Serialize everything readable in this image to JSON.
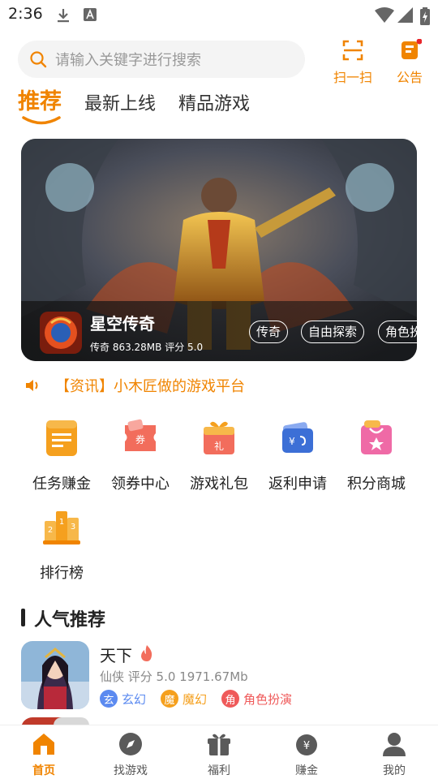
{
  "status_bar": {
    "time": "2:36",
    "icons": [
      "download-icon",
      "a-icon",
      "wifi-icon",
      "signal-icon",
      "battery-icon"
    ]
  },
  "search": {
    "placeholder": "请输入关键字进行搜索"
  },
  "top_actions": [
    {
      "label": "扫一扫",
      "icon": "scan-icon"
    },
    {
      "label": "公告",
      "icon": "notice-icon",
      "badge": true
    }
  ],
  "tabs": [
    {
      "label": "推荐",
      "active": true
    },
    {
      "label": "最新上线",
      "active": false
    },
    {
      "label": "精品游戏",
      "active": false
    }
  ],
  "banner": {
    "title": "星空传奇",
    "meta": "传奇  863.28MB  评分 5.0",
    "tags": [
      "传奇",
      "自由探索",
      "角色扮"
    ]
  },
  "notice": {
    "text": "【资讯】小木匠做的游戏平台"
  },
  "features": [
    {
      "label": "任务赚金",
      "icon": "task-icon",
      "color": "#f5a01e"
    },
    {
      "label": "领券中心",
      "icon": "coupon-icon",
      "color": "#f26d5c"
    },
    {
      "label": "游戏礼包",
      "icon": "gift-icon",
      "color": "#f5a01e"
    },
    {
      "label": "返利申请",
      "icon": "rebate-icon",
      "color": "#3c6fd6"
    },
    {
      "label": "积分商城",
      "icon": "points-mall-icon",
      "color": "#ef6aa6"
    },
    {
      "label": "排行榜",
      "icon": "ranking-icon",
      "color": "#f5a01e"
    }
  ],
  "section": {
    "title": "人气推荐"
  },
  "games": [
    {
      "name": "天下",
      "meta": "仙侠  评分 5.0  1971.67Mb",
      "tags": [
        {
          "char": "玄",
          "label": "玄幻",
          "color": "#5b8af0"
        },
        {
          "char": "魔",
          "label": "魔幻",
          "color": "#f5a01e"
        },
        {
          "char": "角",
          "label": "角色扮演",
          "color": "#ef5a5a"
        }
      ]
    }
  ],
  "bottom_nav": [
    {
      "label": "首页",
      "icon": "home-icon",
      "active": true
    },
    {
      "label": "找游戏",
      "icon": "compass-icon",
      "active": false
    },
    {
      "label": "福利",
      "icon": "gift-icon",
      "active": false
    },
    {
      "label": "赚金",
      "icon": "money-bag-icon",
      "active": false
    },
    {
      "label": "我的",
      "icon": "user-icon",
      "active": false
    }
  ],
  "colors": {
    "accent": "#f08400",
    "text": "#222222",
    "muted": "#888888"
  }
}
